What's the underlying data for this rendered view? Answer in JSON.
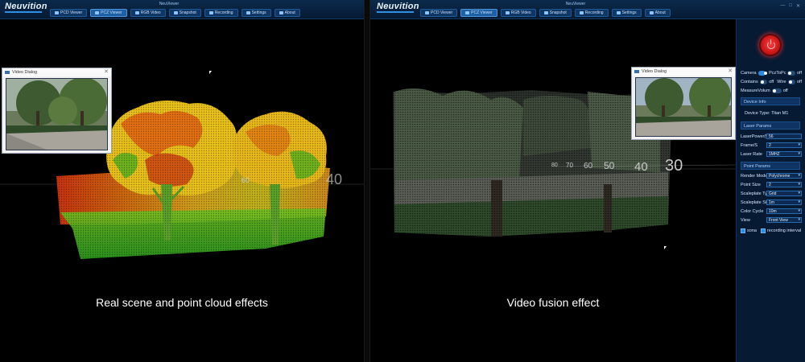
{
  "app": {
    "logo": "Neuvition",
    "title": "NeuViewer",
    "tabs": [
      "PCD Viewer",
      "PCZ Viewer",
      "RGB Video",
      "Snapshot",
      "Recording",
      "Settings",
      "About"
    ],
    "active_tab": "PCZ Viewer"
  },
  "video_dialog": {
    "title": "Video Dialog"
  },
  "left": {
    "caption": "Real scene and point cloud effects"
  },
  "right": {
    "caption": "Video fusion effect",
    "distance_labels": [
      "80",
      "70",
      "60",
      "50",
      "40",
      "30"
    ],
    "left_distance_labels": [
      "60",
      "40"
    ]
  },
  "controls": {
    "camera": {
      "label": "Camera",
      "on": true
    },
    "pcz_to_pc": {
      "label": "PczToPc",
      "state": "off"
    },
    "contains": {
      "label": "Contains",
      "state": "off"
    },
    "wire": {
      "label": "Wire",
      "state": "off"
    },
    "measure_volume": {
      "label": "MeasureVolum",
      "state": "off"
    },
    "device_info": "Device Info",
    "device_type": "Device Type: Titan M1",
    "laser_params": "Laser Params",
    "laser_power": {
      "label": "LaserPower(%)",
      "value": "56"
    },
    "frame_s": {
      "label": "Frame/S",
      "value": "2"
    },
    "laser_rate": {
      "label": "Laser Rate",
      "value": "1MHZ"
    },
    "point_params": "Point Params",
    "render_mode": {
      "label": "Render Mode",
      "value": "Polychrome"
    },
    "point_size": {
      "label": "Point Size",
      "value": "2"
    },
    "scaleplate_type": {
      "label": "Scaleplate Type",
      "value": "Grid"
    },
    "scaleplate_size": {
      "label": "Scaleplate Size",
      "value": "1m"
    },
    "color_cycle": {
      "label": "Color Cycle",
      "value": "10m"
    },
    "view": {
      "label": "View",
      "value": "Front View"
    },
    "sona": "sona",
    "recording_interval": "recording interval"
  },
  "colors": {
    "accent": "#2a8be0",
    "topbar": "#0b2a4c",
    "power": "#e02020"
  }
}
